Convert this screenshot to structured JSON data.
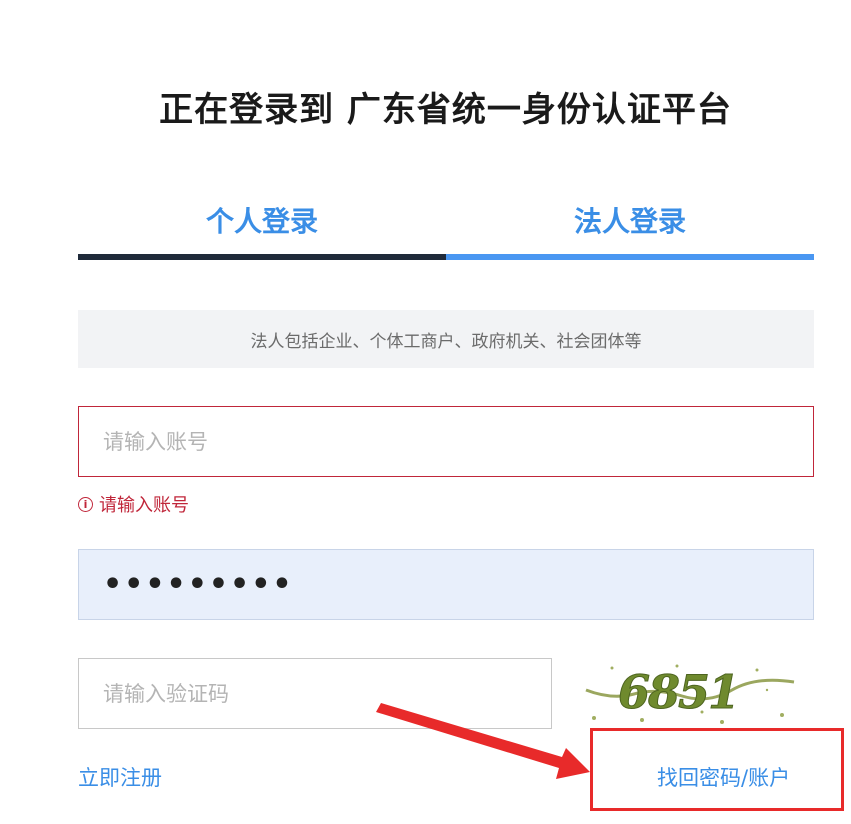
{
  "header": {
    "title": "正在登录到 广东省统一身份认证平台"
  },
  "tabs": [
    {
      "label": "个人登录",
      "active": false
    },
    {
      "label": "法人登录",
      "active": true
    }
  ],
  "notice": {
    "text": "法人包括企业、个体工商户、政府机关、社会团体等"
  },
  "form": {
    "account": {
      "placeholder": "请输入账号",
      "value": ""
    },
    "account_error": {
      "text": "请输入账号",
      "icon": "info-circle-icon"
    },
    "password": {
      "value": "•••••••••"
    },
    "captcha": {
      "placeholder": "请输入验证码",
      "value": ""
    },
    "captcha_image_text": "6851"
  },
  "links": {
    "register": "立即注册",
    "forgot": "找回密码/账户"
  },
  "colors": {
    "accent": "#3a8ee6",
    "error": "#c0263a",
    "annotation": "#e82a2a"
  }
}
